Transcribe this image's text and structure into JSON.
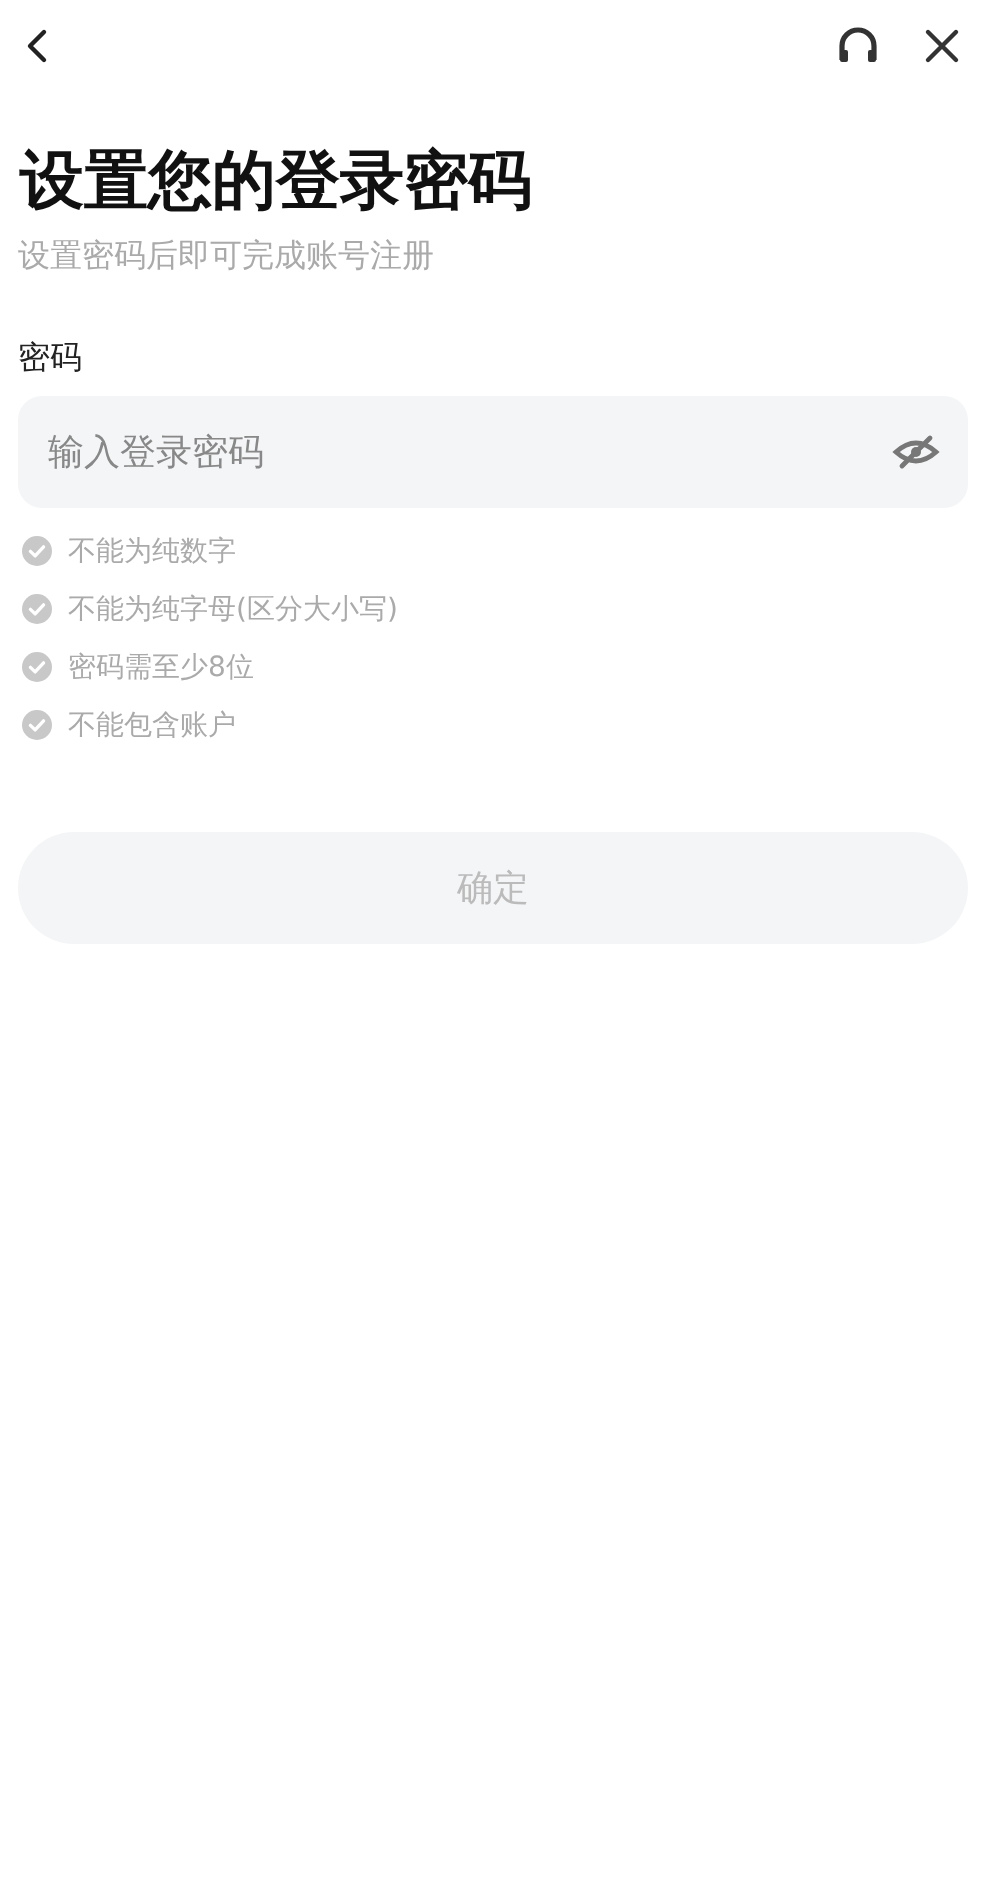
{
  "title": "设置您的登录密码",
  "subtitle": "设置密码后即可完成账号注册",
  "password": {
    "label": "密码",
    "placeholder": "输入登录密码",
    "visible": false
  },
  "rules": [
    {
      "text": "不能为纯数字",
      "met": false
    },
    {
      "text": "不能为纯字母(区分大小写)",
      "met": false
    },
    {
      "text": "密码需至少8位",
      "met": false
    },
    {
      "text": "不能包含账户",
      "met": false
    }
  ],
  "confirm": {
    "label": "确定",
    "disabled": true
  }
}
